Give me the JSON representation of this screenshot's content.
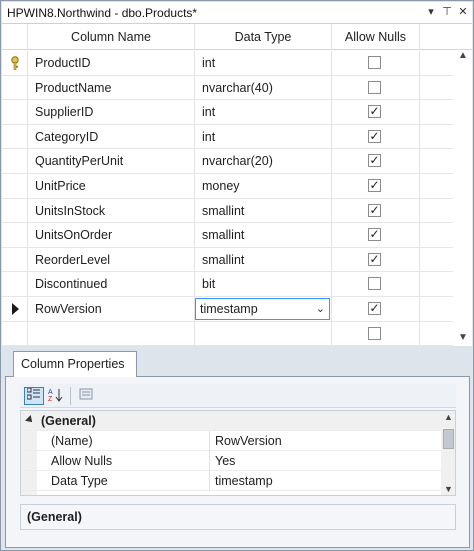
{
  "window": {
    "title": "HPWIN8.Northwind - dbo.Products*",
    "pin_glyph": "▾",
    "pushpin_glyph": "⊤",
    "close_glyph": "✕"
  },
  "designer": {
    "columns": [
      "Column Name",
      "Data Type",
      "Allow Nulls"
    ],
    "rows": [
      {
        "name": "ProductID",
        "type": "int",
        "allow_nulls": false,
        "primary_key": true
      },
      {
        "name": "ProductName",
        "type": "nvarchar(40)",
        "allow_nulls": false
      },
      {
        "name": "SupplierID",
        "type": "int",
        "allow_nulls": true
      },
      {
        "name": "CategoryID",
        "type": "int",
        "allow_nulls": true
      },
      {
        "name": "QuantityPerUnit",
        "type": "nvarchar(20)",
        "allow_nulls": true
      },
      {
        "name": "UnitPrice",
        "type": "money",
        "allow_nulls": true
      },
      {
        "name": "UnitsInStock",
        "type": "smallint",
        "allow_nulls": true
      },
      {
        "name": "UnitsOnOrder",
        "type": "smallint",
        "allow_nulls": true
      },
      {
        "name": "ReorderLevel",
        "type": "smallint",
        "allow_nulls": true
      },
      {
        "name": "Discontinued",
        "type": "bit",
        "allow_nulls": false
      },
      {
        "name": "RowVersion",
        "type": "timestamp",
        "allow_nulls": true,
        "current": true,
        "editing": true
      },
      {
        "name": "",
        "type": "",
        "allow_nulls": false
      }
    ]
  },
  "properties": {
    "tab_label": "Column Properties",
    "toolbar": {
      "categorized_icon": "categorized-icon",
      "alphabetical_icon": "sort-az-icon",
      "property_pages_icon": "property-pages-icon"
    },
    "grid": [
      {
        "kind": "category",
        "name": "(General)"
      },
      {
        "kind": "prop",
        "name": "(Name)",
        "value": "RowVersion"
      },
      {
        "kind": "prop",
        "name": "Allow Nulls",
        "value": "Yes"
      },
      {
        "kind": "prop",
        "name": "Data Type",
        "value": "timestamp"
      }
    ],
    "description": "(General)"
  },
  "colors": {
    "frame": "#dee4ec",
    "border": "#8a98a8",
    "selection": "#3399ff"
  }
}
